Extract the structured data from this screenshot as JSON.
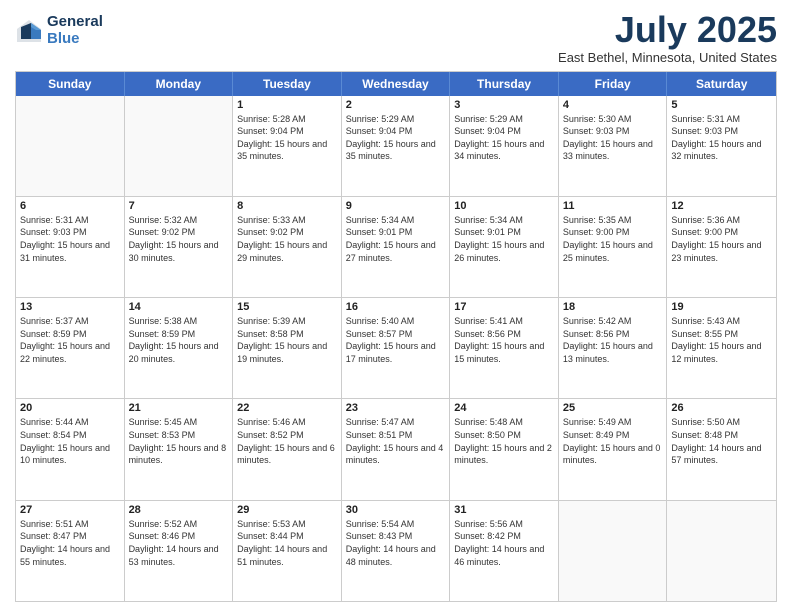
{
  "logo": {
    "line1": "General",
    "line2": "Blue"
  },
  "title": "July 2025",
  "location": "East Bethel, Minnesota, United States",
  "headers": [
    "Sunday",
    "Monday",
    "Tuesday",
    "Wednesday",
    "Thursday",
    "Friday",
    "Saturday"
  ],
  "weeks": [
    [
      {
        "day": "",
        "info": ""
      },
      {
        "day": "",
        "info": ""
      },
      {
        "day": "1",
        "info": "Sunrise: 5:28 AM\nSunset: 9:04 PM\nDaylight: 15 hours and 35 minutes."
      },
      {
        "day": "2",
        "info": "Sunrise: 5:29 AM\nSunset: 9:04 PM\nDaylight: 15 hours and 35 minutes."
      },
      {
        "day": "3",
        "info": "Sunrise: 5:29 AM\nSunset: 9:04 PM\nDaylight: 15 hours and 34 minutes."
      },
      {
        "day": "4",
        "info": "Sunrise: 5:30 AM\nSunset: 9:03 PM\nDaylight: 15 hours and 33 minutes."
      },
      {
        "day": "5",
        "info": "Sunrise: 5:31 AM\nSunset: 9:03 PM\nDaylight: 15 hours and 32 minutes."
      }
    ],
    [
      {
        "day": "6",
        "info": "Sunrise: 5:31 AM\nSunset: 9:03 PM\nDaylight: 15 hours and 31 minutes."
      },
      {
        "day": "7",
        "info": "Sunrise: 5:32 AM\nSunset: 9:02 PM\nDaylight: 15 hours and 30 minutes."
      },
      {
        "day": "8",
        "info": "Sunrise: 5:33 AM\nSunset: 9:02 PM\nDaylight: 15 hours and 29 minutes."
      },
      {
        "day": "9",
        "info": "Sunrise: 5:34 AM\nSunset: 9:01 PM\nDaylight: 15 hours and 27 minutes."
      },
      {
        "day": "10",
        "info": "Sunrise: 5:34 AM\nSunset: 9:01 PM\nDaylight: 15 hours and 26 minutes."
      },
      {
        "day": "11",
        "info": "Sunrise: 5:35 AM\nSunset: 9:00 PM\nDaylight: 15 hours and 25 minutes."
      },
      {
        "day": "12",
        "info": "Sunrise: 5:36 AM\nSunset: 9:00 PM\nDaylight: 15 hours and 23 minutes."
      }
    ],
    [
      {
        "day": "13",
        "info": "Sunrise: 5:37 AM\nSunset: 8:59 PM\nDaylight: 15 hours and 22 minutes."
      },
      {
        "day": "14",
        "info": "Sunrise: 5:38 AM\nSunset: 8:59 PM\nDaylight: 15 hours and 20 minutes."
      },
      {
        "day": "15",
        "info": "Sunrise: 5:39 AM\nSunset: 8:58 PM\nDaylight: 15 hours and 19 minutes."
      },
      {
        "day": "16",
        "info": "Sunrise: 5:40 AM\nSunset: 8:57 PM\nDaylight: 15 hours and 17 minutes."
      },
      {
        "day": "17",
        "info": "Sunrise: 5:41 AM\nSunset: 8:56 PM\nDaylight: 15 hours and 15 minutes."
      },
      {
        "day": "18",
        "info": "Sunrise: 5:42 AM\nSunset: 8:56 PM\nDaylight: 15 hours and 13 minutes."
      },
      {
        "day": "19",
        "info": "Sunrise: 5:43 AM\nSunset: 8:55 PM\nDaylight: 15 hours and 12 minutes."
      }
    ],
    [
      {
        "day": "20",
        "info": "Sunrise: 5:44 AM\nSunset: 8:54 PM\nDaylight: 15 hours and 10 minutes."
      },
      {
        "day": "21",
        "info": "Sunrise: 5:45 AM\nSunset: 8:53 PM\nDaylight: 15 hours and 8 minutes."
      },
      {
        "day": "22",
        "info": "Sunrise: 5:46 AM\nSunset: 8:52 PM\nDaylight: 15 hours and 6 minutes."
      },
      {
        "day": "23",
        "info": "Sunrise: 5:47 AM\nSunset: 8:51 PM\nDaylight: 15 hours and 4 minutes."
      },
      {
        "day": "24",
        "info": "Sunrise: 5:48 AM\nSunset: 8:50 PM\nDaylight: 15 hours and 2 minutes."
      },
      {
        "day": "25",
        "info": "Sunrise: 5:49 AM\nSunset: 8:49 PM\nDaylight: 15 hours and 0 minutes."
      },
      {
        "day": "26",
        "info": "Sunrise: 5:50 AM\nSunset: 8:48 PM\nDaylight: 14 hours and 57 minutes."
      }
    ],
    [
      {
        "day": "27",
        "info": "Sunrise: 5:51 AM\nSunset: 8:47 PM\nDaylight: 14 hours and 55 minutes."
      },
      {
        "day": "28",
        "info": "Sunrise: 5:52 AM\nSunset: 8:46 PM\nDaylight: 14 hours and 53 minutes."
      },
      {
        "day": "29",
        "info": "Sunrise: 5:53 AM\nSunset: 8:44 PM\nDaylight: 14 hours and 51 minutes."
      },
      {
        "day": "30",
        "info": "Sunrise: 5:54 AM\nSunset: 8:43 PM\nDaylight: 14 hours and 48 minutes."
      },
      {
        "day": "31",
        "info": "Sunrise: 5:56 AM\nSunset: 8:42 PM\nDaylight: 14 hours and 46 minutes."
      },
      {
        "day": "",
        "info": ""
      },
      {
        "day": "",
        "info": ""
      }
    ]
  ]
}
